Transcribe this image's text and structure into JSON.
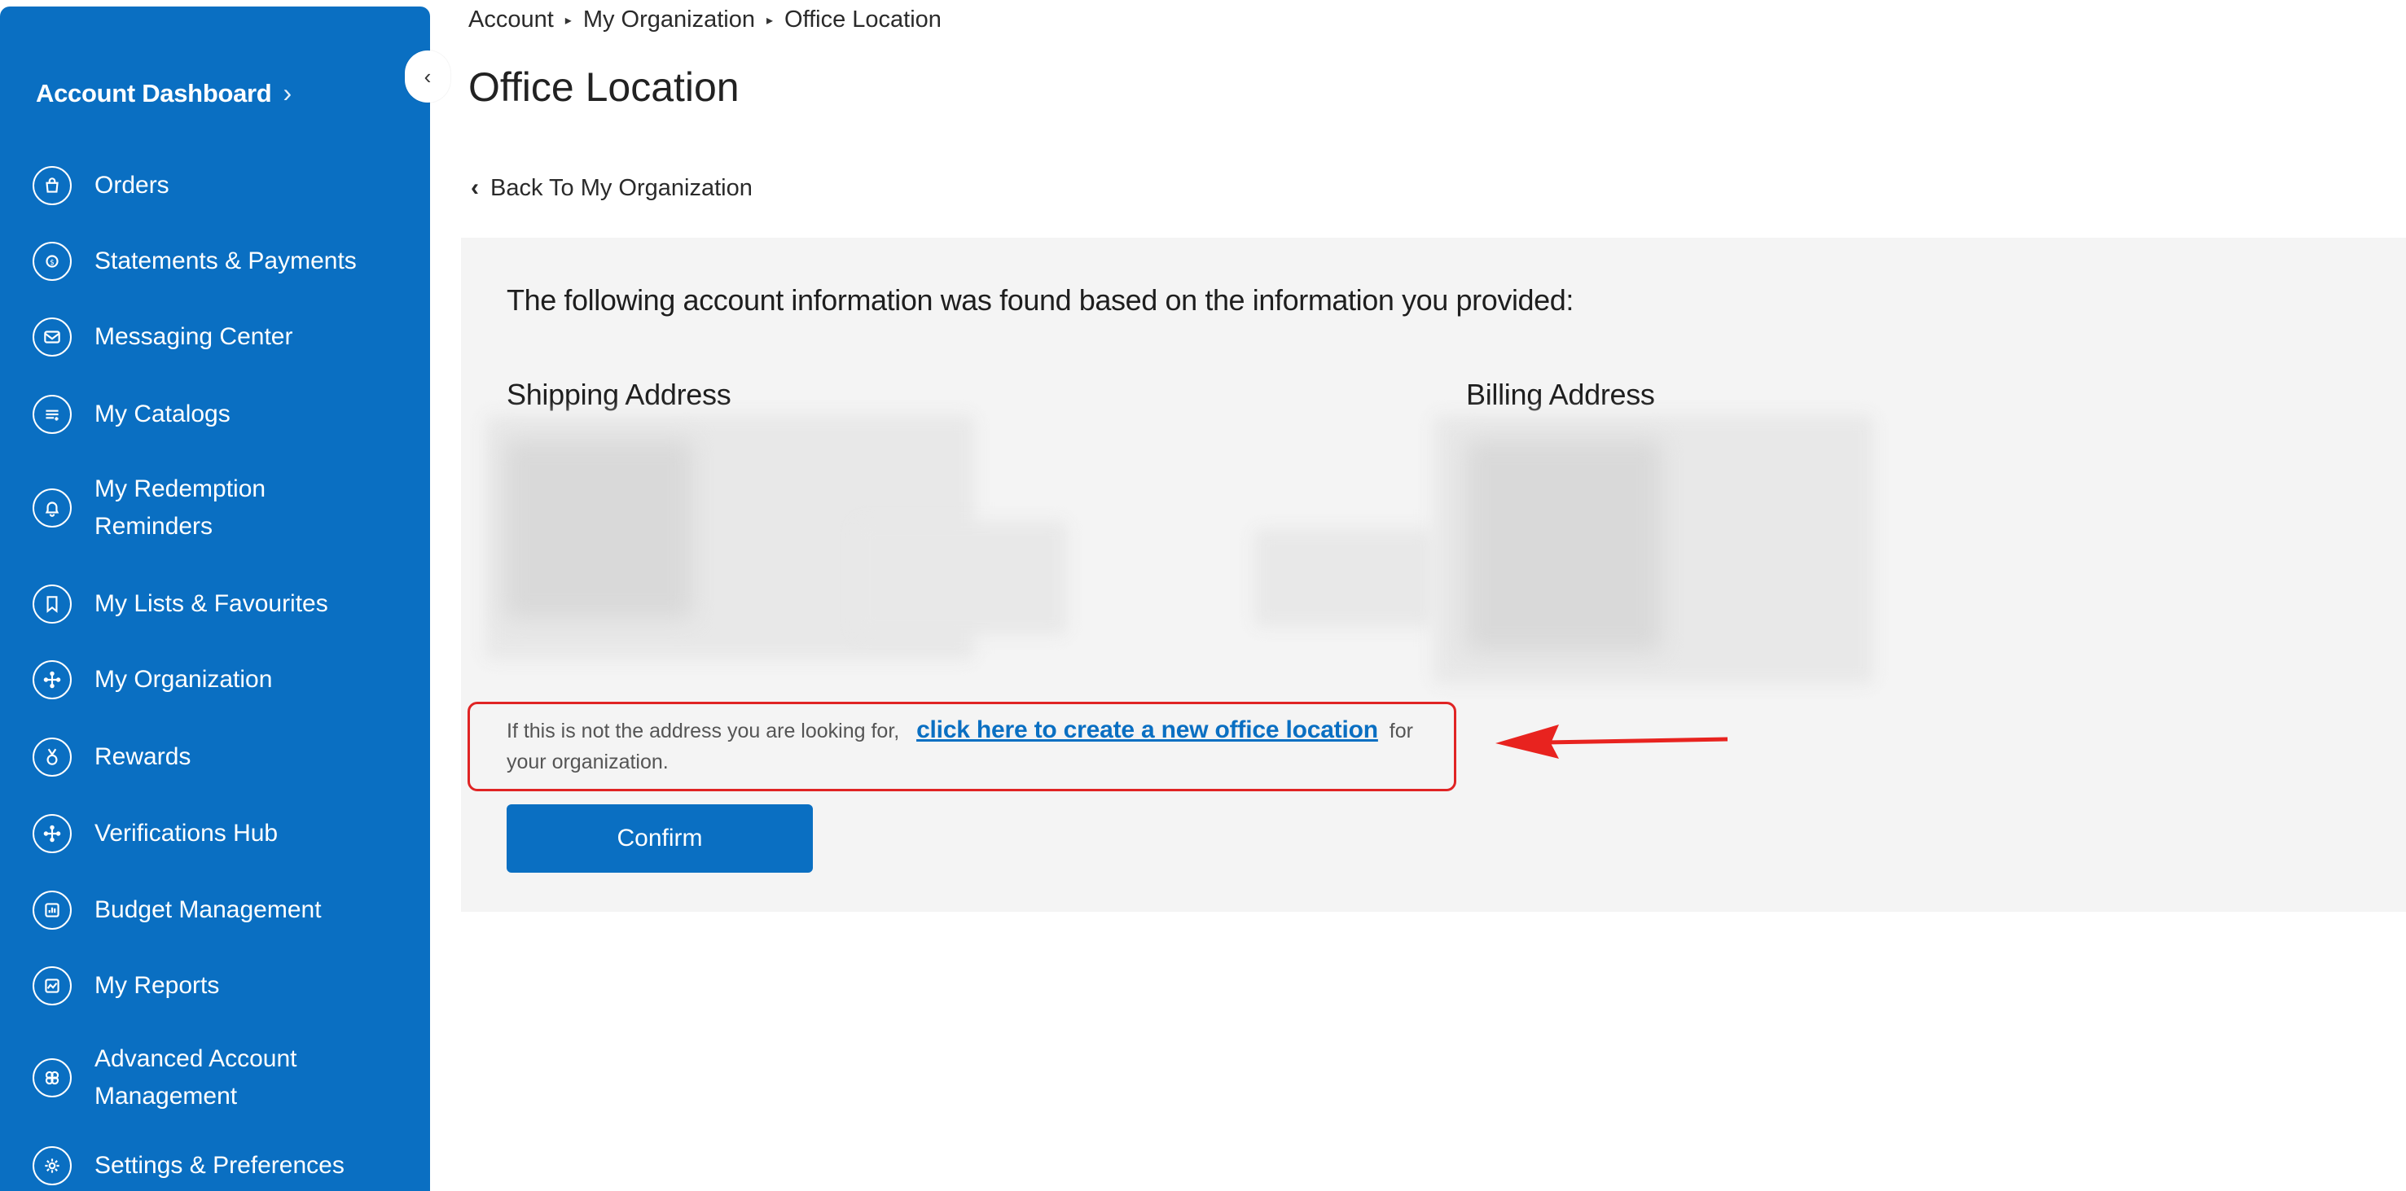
{
  "sidebar": {
    "collapse_glyph": "‹",
    "dashboard_label": "Account Dashboard",
    "dashboard_chevron": "›",
    "items": [
      {
        "label": "Orders",
        "icon": "shopping-bag-icon"
      },
      {
        "label": "Statements & Payments",
        "icon": "coin-icon"
      },
      {
        "label": "Messaging Center",
        "icon": "envelope-icon"
      },
      {
        "label": "My Catalogs",
        "icon": "list-icon"
      },
      {
        "label": "My Redemption Reminders",
        "icon": "bell-icon"
      },
      {
        "label": "My Lists & Favourites",
        "icon": "bookmark-icon"
      },
      {
        "label": "My Organization",
        "icon": "org-chart-icon"
      },
      {
        "label": "Rewards",
        "icon": "medal-icon"
      },
      {
        "label": "Verifications Hub",
        "icon": "hub-icon"
      },
      {
        "label": "Budget Management",
        "icon": "bar-chart-icon"
      },
      {
        "label": "My Reports",
        "icon": "trend-icon"
      },
      {
        "label": "Advanced Account Management",
        "icon": "settings-cluster-icon"
      },
      {
        "label": "Settings & Preferences",
        "icon": "gear-icon"
      }
    ]
  },
  "breadcrumb": {
    "items": [
      "Account",
      "My Organization",
      "Office Location"
    ],
    "separator": "▸"
  },
  "page": {
    "title": "Office Location",
    "back_label": "Back To My Organization",
    "back_glyph": "‹"
  },
  "panel": {
    "info_text": "The following account information was found based on the information you provided:",
    "shipping_heading": "Shipping Address",
    "billing_heading": "Billing Address",
    "note_prefix": "If this is not the address you are looking for,",
    "note_link": "click here to create a new office location",
    "note_suffix": "for your organization.",
    "confirm_label": "Confirm"
  },
  "colors": {
    "sidebar_bg": "#0a6fc2",
    "accent": "#0a6fc2",
    "panel_bg": "#f4f4f4",
    "highlight_red": "#e02424"
  }
}
